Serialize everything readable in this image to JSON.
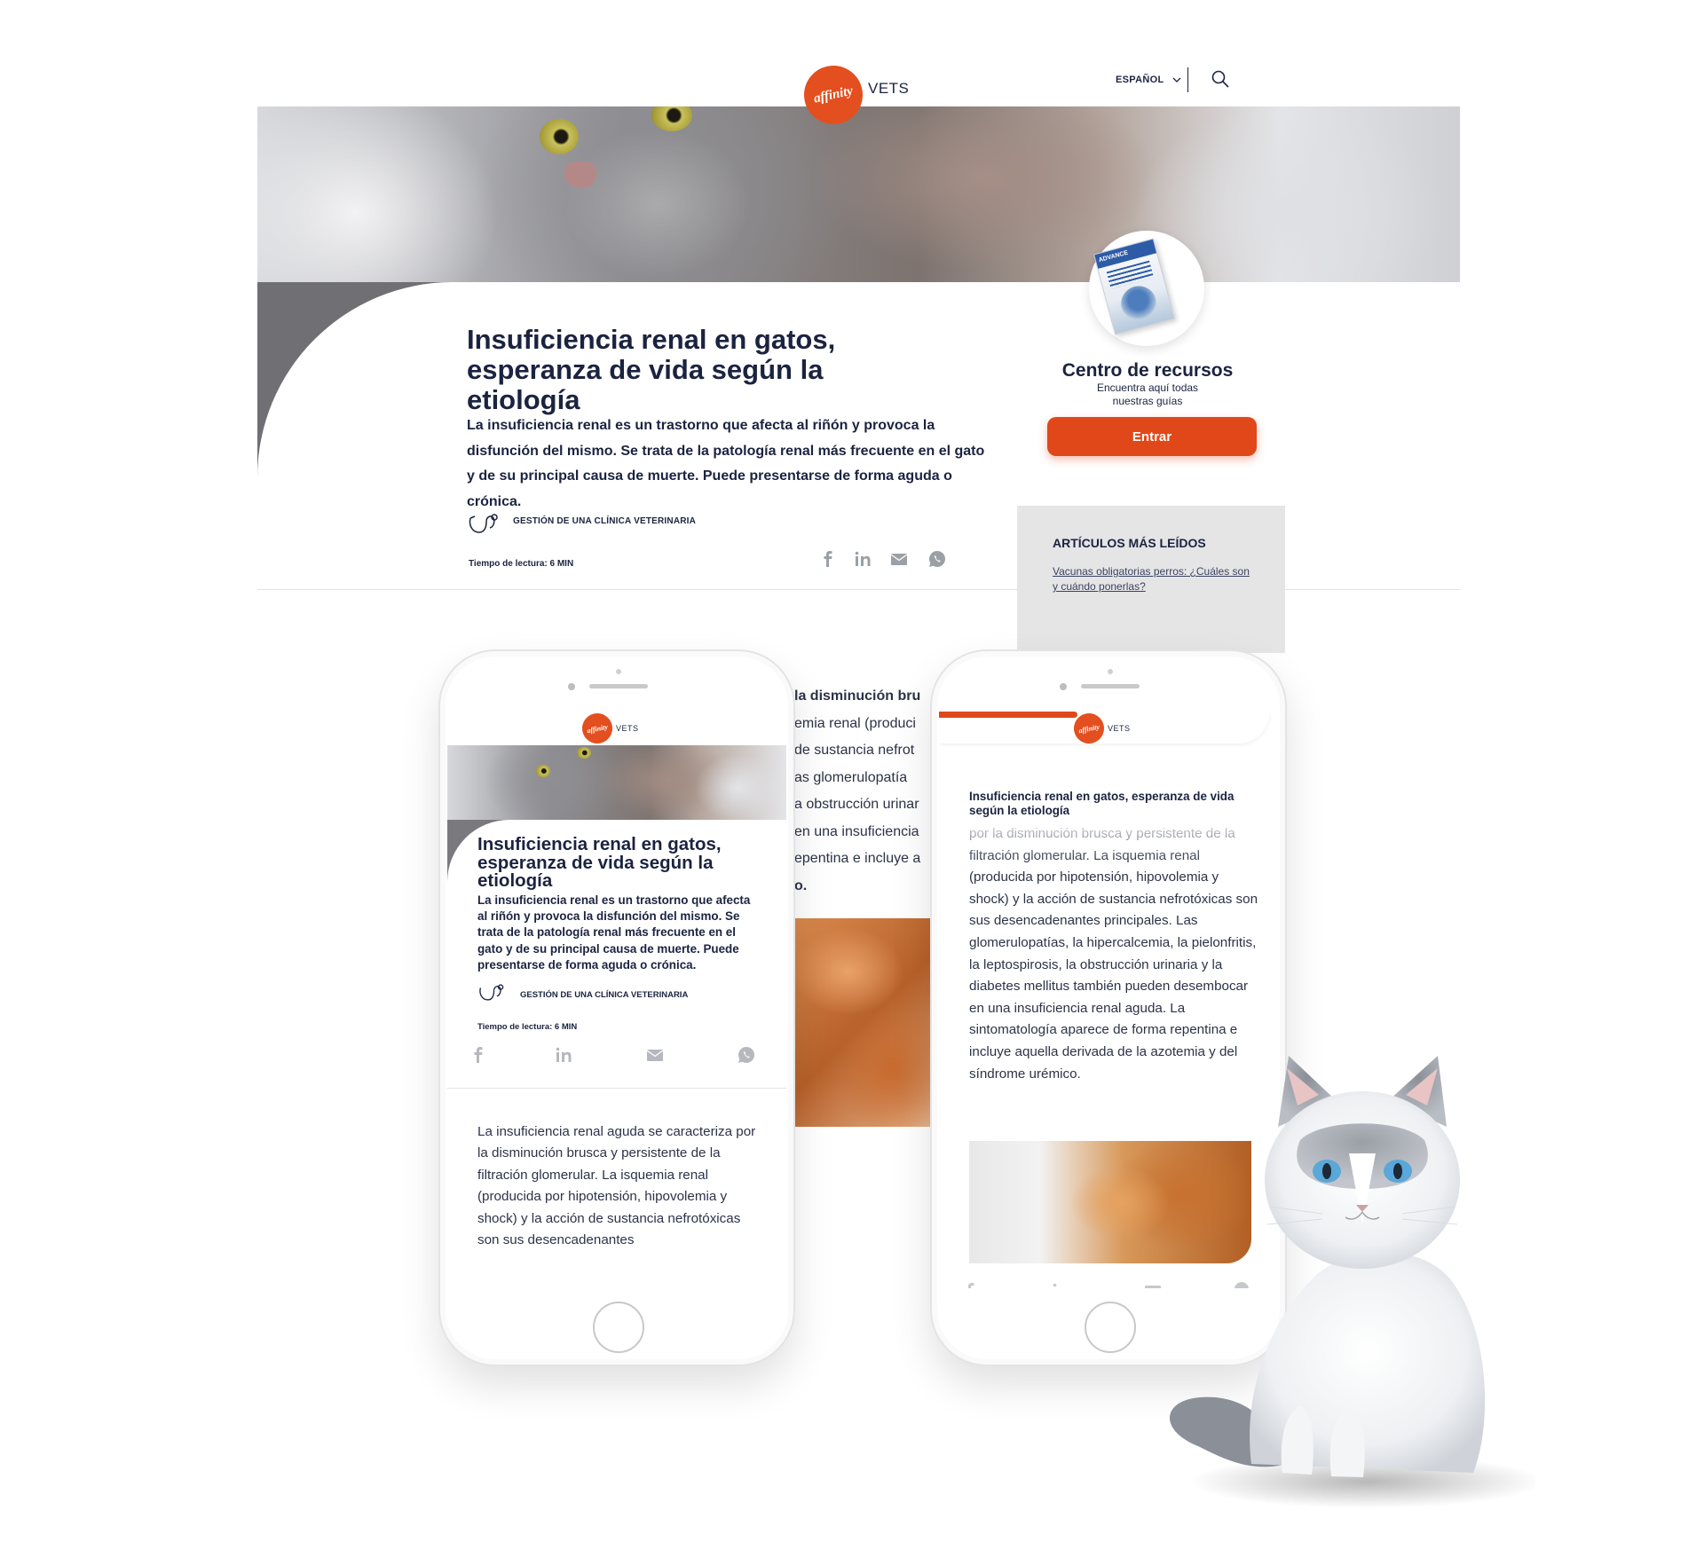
{
  "desktop": {
    "brand": {
      "logo_text": "affinity",
      "suffix": "VETS"
    },
    "header": {
      "language": "ESPAÑOL"
    },
    "article": {
      "title": "Insuficiencia renal en gatos, esperanza de vida según la etiología",
      "intro": "La insuficiencia renal es un trastorno que afecta al riñón y provoca la disfunción del mismo. Se trata de la patología renal más frecuente en el gato y de su principal causa de muerte. Puede presentarse de forma aguda o crónica.",
      "category": "GESTIÓN DE UNA CLÍNICA VETERINARIA",
      "reading_time": "Tiempo de lectura: 6 MIN"
    },
    "resources": {
      "book_cover": "ADVANCE",
      "title": "Centro de recursos",
      "subtitle": "Encuentra aquí todas nuestras guías",
      "button": "Entrar"
    },
    "most_read": {
      "title": "ARTÍCULOS MÁS LEÍDOS",
      "first_link": "Vacunas obligatorias perros: ¿Cuáles son y cuándo ponerlas?"
    },
    "peek_lines": [
      "la disminución bru",
      "emia renal (produci",
      "de sustancia nefrot",
      "as glomerulopatía",
      "a obstrucción urinar",
      "en una insuficiencia",
      "epentina e incluye a",
      "o."
    ]
  },
  "phone1": {
    "brand": {
      "logo_text": "affinity",
      "suffix": "VETS"
    },
    "title": "Insuficiencia renal en gatos, esperanza de vida según la etiología",
    "intro": "La insuficiencia renal es un trastorno que afecta al riñón y provoca la disfunción del mismo. Se trata de la patología renal más frecuente en el gato y de su principal causa de muerte. Puede presentarse de forma aguda o crónica.",
    "category": "GESTIÓN DE UNA CLÍNICA VETERINARIA",
    "reading_time": "Tiempo de lectura: 6 MIN",
    "body": "La insuficiencia renal aguda se caracteriza por la disminución brusca y persistente de la filtración glomerular. La isquemia renal (producida por hipotensión, hipovolemia y shock) y la acción de sustancia nefrotóxicas son sus desencadenantes"
  },
  "phone2": {
    "brand": {
      "logo_text": "affinity",
      "suffix": "VETS"
    },
    "title": "Insuficiencia renal en gatos, esperanza de vida según la etiología",
    "body": "por la disminución brusca y persistente de la filtración glomerular. La isquemia renal (producida por hipotensión, hipovolemia y shock) y la acción de sustancia nefrotóxicas son sus desencadenantes principales. Las glomerulopatías, la hipercalcemia, la pielonfritis, la leptospirosis, la obstrucción urinaria y la diabetes mellitus también pueden desembocar en una insuficiencia renal aguda.  La sintomatología aparece de forma repentina e incluye aquella derivada de la azotemia y del síndrome urémico.",
    "reading_progress": 0.42
  },
  "colors": {
    "brand_orange": "#e0481a",
    "navy_text": "#1b2340",
    "share_gray": "#9aa0a6"
  }
}
